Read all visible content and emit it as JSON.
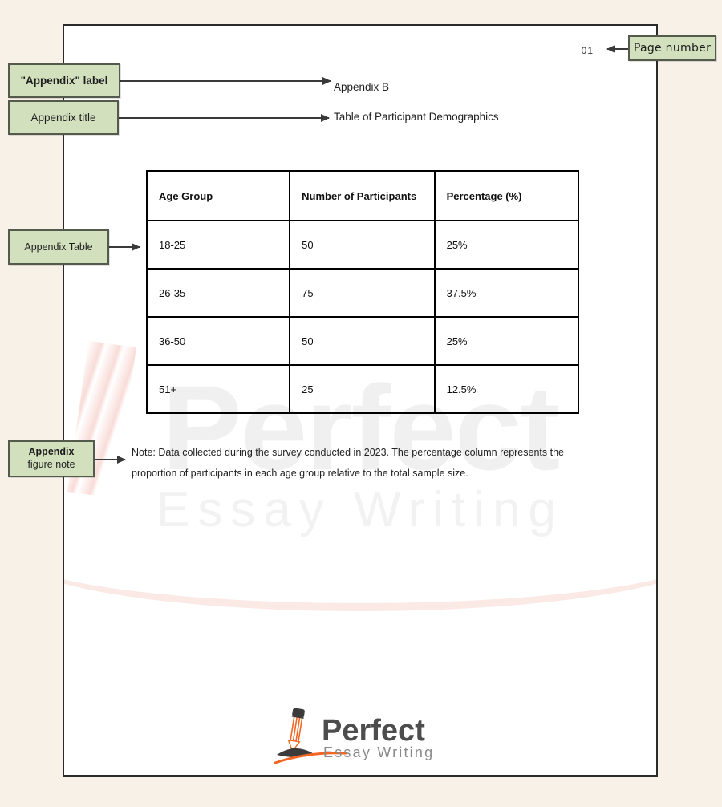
{
  "theme": {
    "canvas_bg": "#f7f1e8",
    "page_bg": "#ffffff",
    "page_border": "#2b2b2b",
    "callout_fill": "#d3e0bd",
    "callout_border": "#545b4c",
    "accent_orange": "#f26522",
    "logo_dark": "#4d4d4d"
  },
  "document": {
    "page_number": "01",
    "appendix_label": "Appendix B",
    "appendix_title": "Table of Participant Demographics",
    "note": "Note: Data collected during the survey conducted in 2023. The percentage column represents the proportion of participants in each age group relative to the total sample size."
  },
  "table": {
    "headers": [
      "Age Group",
      "Number of Participants",
      "Percentage (%)"
    ],
    "rows": [
      [
        "18-25",
        "50",
        "25%"
      ],
      [
        "26-35",
        "75",
        "37.5%"
      ],
      [
        "36-50",
        "50",
        "25%"
      ],
      [
        "51+",
        "25",
        "12.5%"
      ]
    ]
  },
  "callouts": {
    "page_number": "Page number",
    "appendix_label": "\"Appendix\" label",
    "appendix_title": "Appendix title",
    "appendix_table": "Appendix Table",
    "figure_note_line1": "Appendix",
    "figure_note_line2": "figure note"
  },
  "logo": {
    "name_main": "Perfect",
    "name_sub": "Essay Writing",
    "icon": "pencil-icon"
  },
  "watermark": {
    "main": "Perfect",
    "sub": "Essay Writing"
  }
}
